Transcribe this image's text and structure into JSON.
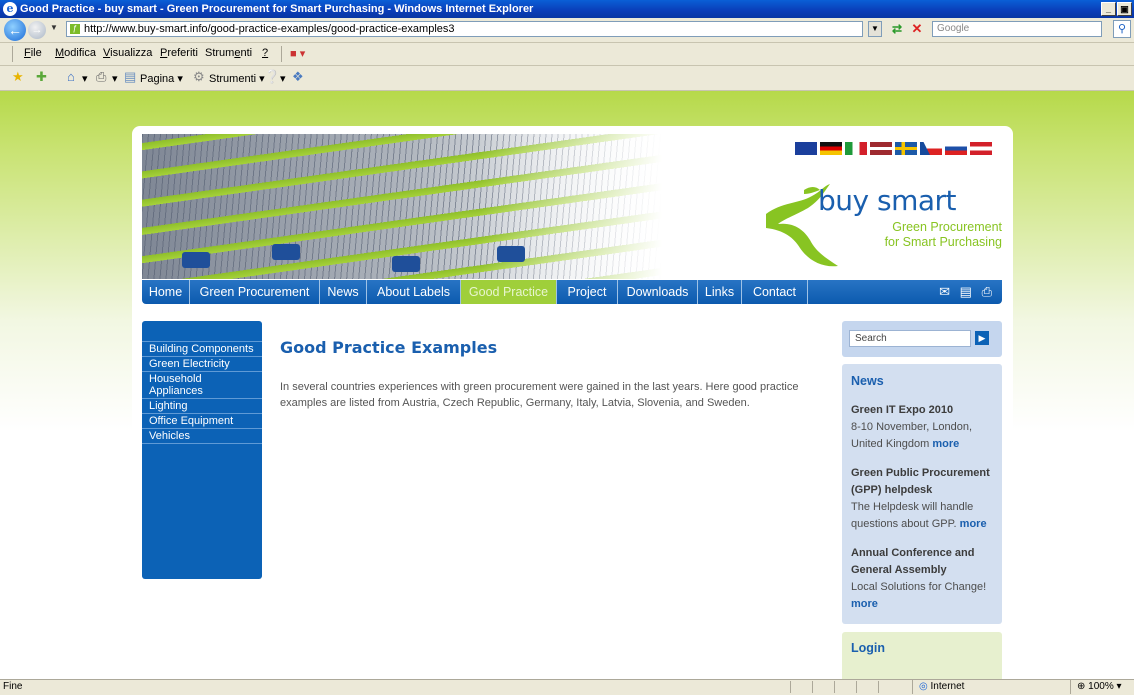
{
  "window": {
    "title": "Good Practice - buy smart - Green Procurement for Smart Purchasing - Windows Internet Explorer",
    "buttons": [
      "_",
      "▣"
    ]
  },
  "address_bar": {
    "url": "http://www.buy-smart.info/good-practice-examples/good-practice-examples3",
    "search_placeholder": "Google"
  },
  "menu": {
    "items": [
      {
        "ul": "F",
        "rest": "ile"
      },
      {
        "ul": "M",
        "rest": "odifica"
      },
      {
        "ul": "V",
        "rest": "isualizza"
      },
      {
        "ul": "P",
        "rest": "referiti"
      },
      {
        "pre": "Strum",
        "ul": "e",
        "rest": "nti"
      },
      {
        "ul": "?",
        "rest": ""
      }
    ]
  },
  "favorites_bar": {
    "page_label": "Pagina",
    "tools_label": "Strumenti"
  },
  "site": {
    "logo_title": "buy smart",
    "logo_sub1": "Green Procurement",
    "logo_sub2": "for Smart Purchasing",
    "top_nav": [
      {
        "label": "Home"
      },
      {
        "label": "Green Procurement"
      },
      {
        "label": "News"
      },
      {
        "label": "About Labels"
      },
      {
        "label": "Good Practice"
      },
      {
        "label": "Project"
      },
      {
        "label": "Downloads"
      },
      {
        "label": "Links"
      },
      {
        "label": "Contact"
      }
    ],
    "side_nav": [
      {
        "label": "Building Components"
      },
      {
        "label": "Green Electricity"
      },
      {
        "label": "Household Appliances"
      },
      {
        "label": "Lighting"
      },
      {
        "label": "Office Equipment"
      },
      {
        "label": "Vehicles"
      }
    ],
    "content": {
      "title": "Good Practice Examples",
      "text": "In several countries experiences with green procurement were gained in the last years. Here good practice examples are listed from Austria, Czech Republic, Germany, Italy, Latvia, Slovenia, and Sweden."
    },
    "search": {
      "value": "Search"
    },
    "news": {
      "heading": "News",
      "items": [
        {
          "title": "Green IT Expo 2010",
          "body": "8-10 November, London, United Kingdom",
          "more": "more"
        },
        {
          "title": "Green Public Procurement (GPP) helpdesk",
          "body": "The Helpdesk will handle questions about GPP.",
          "more": "more"
        },
        {
          "title": "Annual Conference and General Assembly",
          "body": "Local Solutions for Change!",
          "more": "more"
        }
      ]
    },
    "login": {
      "heading": "Login"
    }
  },
  "status_bar": {
    "text": "Fine",
    "zone": "Internet",
    "zoom": "100%"
  },
  "colors": {
    "brand_blue": "#1a5fae",
    "brand_green": "#9fcf3a",
    "nav_blue": "#0c62b6"
  }
}
